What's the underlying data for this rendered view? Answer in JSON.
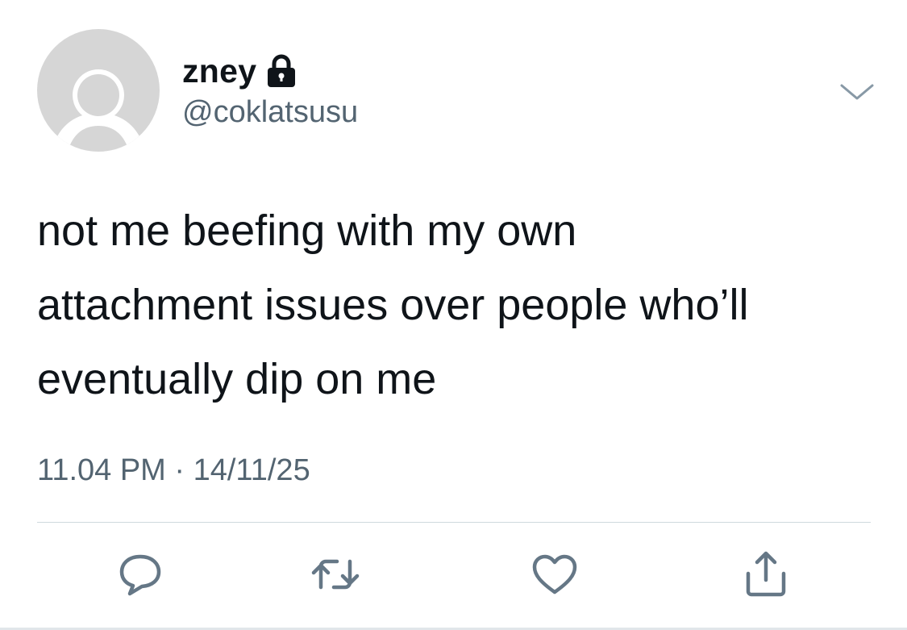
{
  "tweet": {
    "author": {
      "display_name": "zney",
      "handle": "@coklatsusu",
      "protected_icon": "lock-icon",
      "avatar": "default-avatar"
    },
    "text": "not me beefing with my own\nattachment issues over people who’ll\neventually dip on me",
    "timestamp": "11.04 PM · 14/11/25",
    "menu_icon": "chevron-down-icon",
    "actions": [
      {
        "name": "reply",
        "icon": "comment-icon"
      },
      {
        "name": "retweet",
        "icon": "retweet-icon"
      },
      {
        "name": "like",
        "icon": "heart-icon"
      },
      {
        "name": "share",
        "icon": "share-icon"
      }
    ]
  },
  "colors": {
    "text": "#0f1419",
    "secondary": "#536471",
    "avatar_bg": "#d6d6d6",
    "icon": "#657786",
    "divider": "#cfd9de"
  }
}
